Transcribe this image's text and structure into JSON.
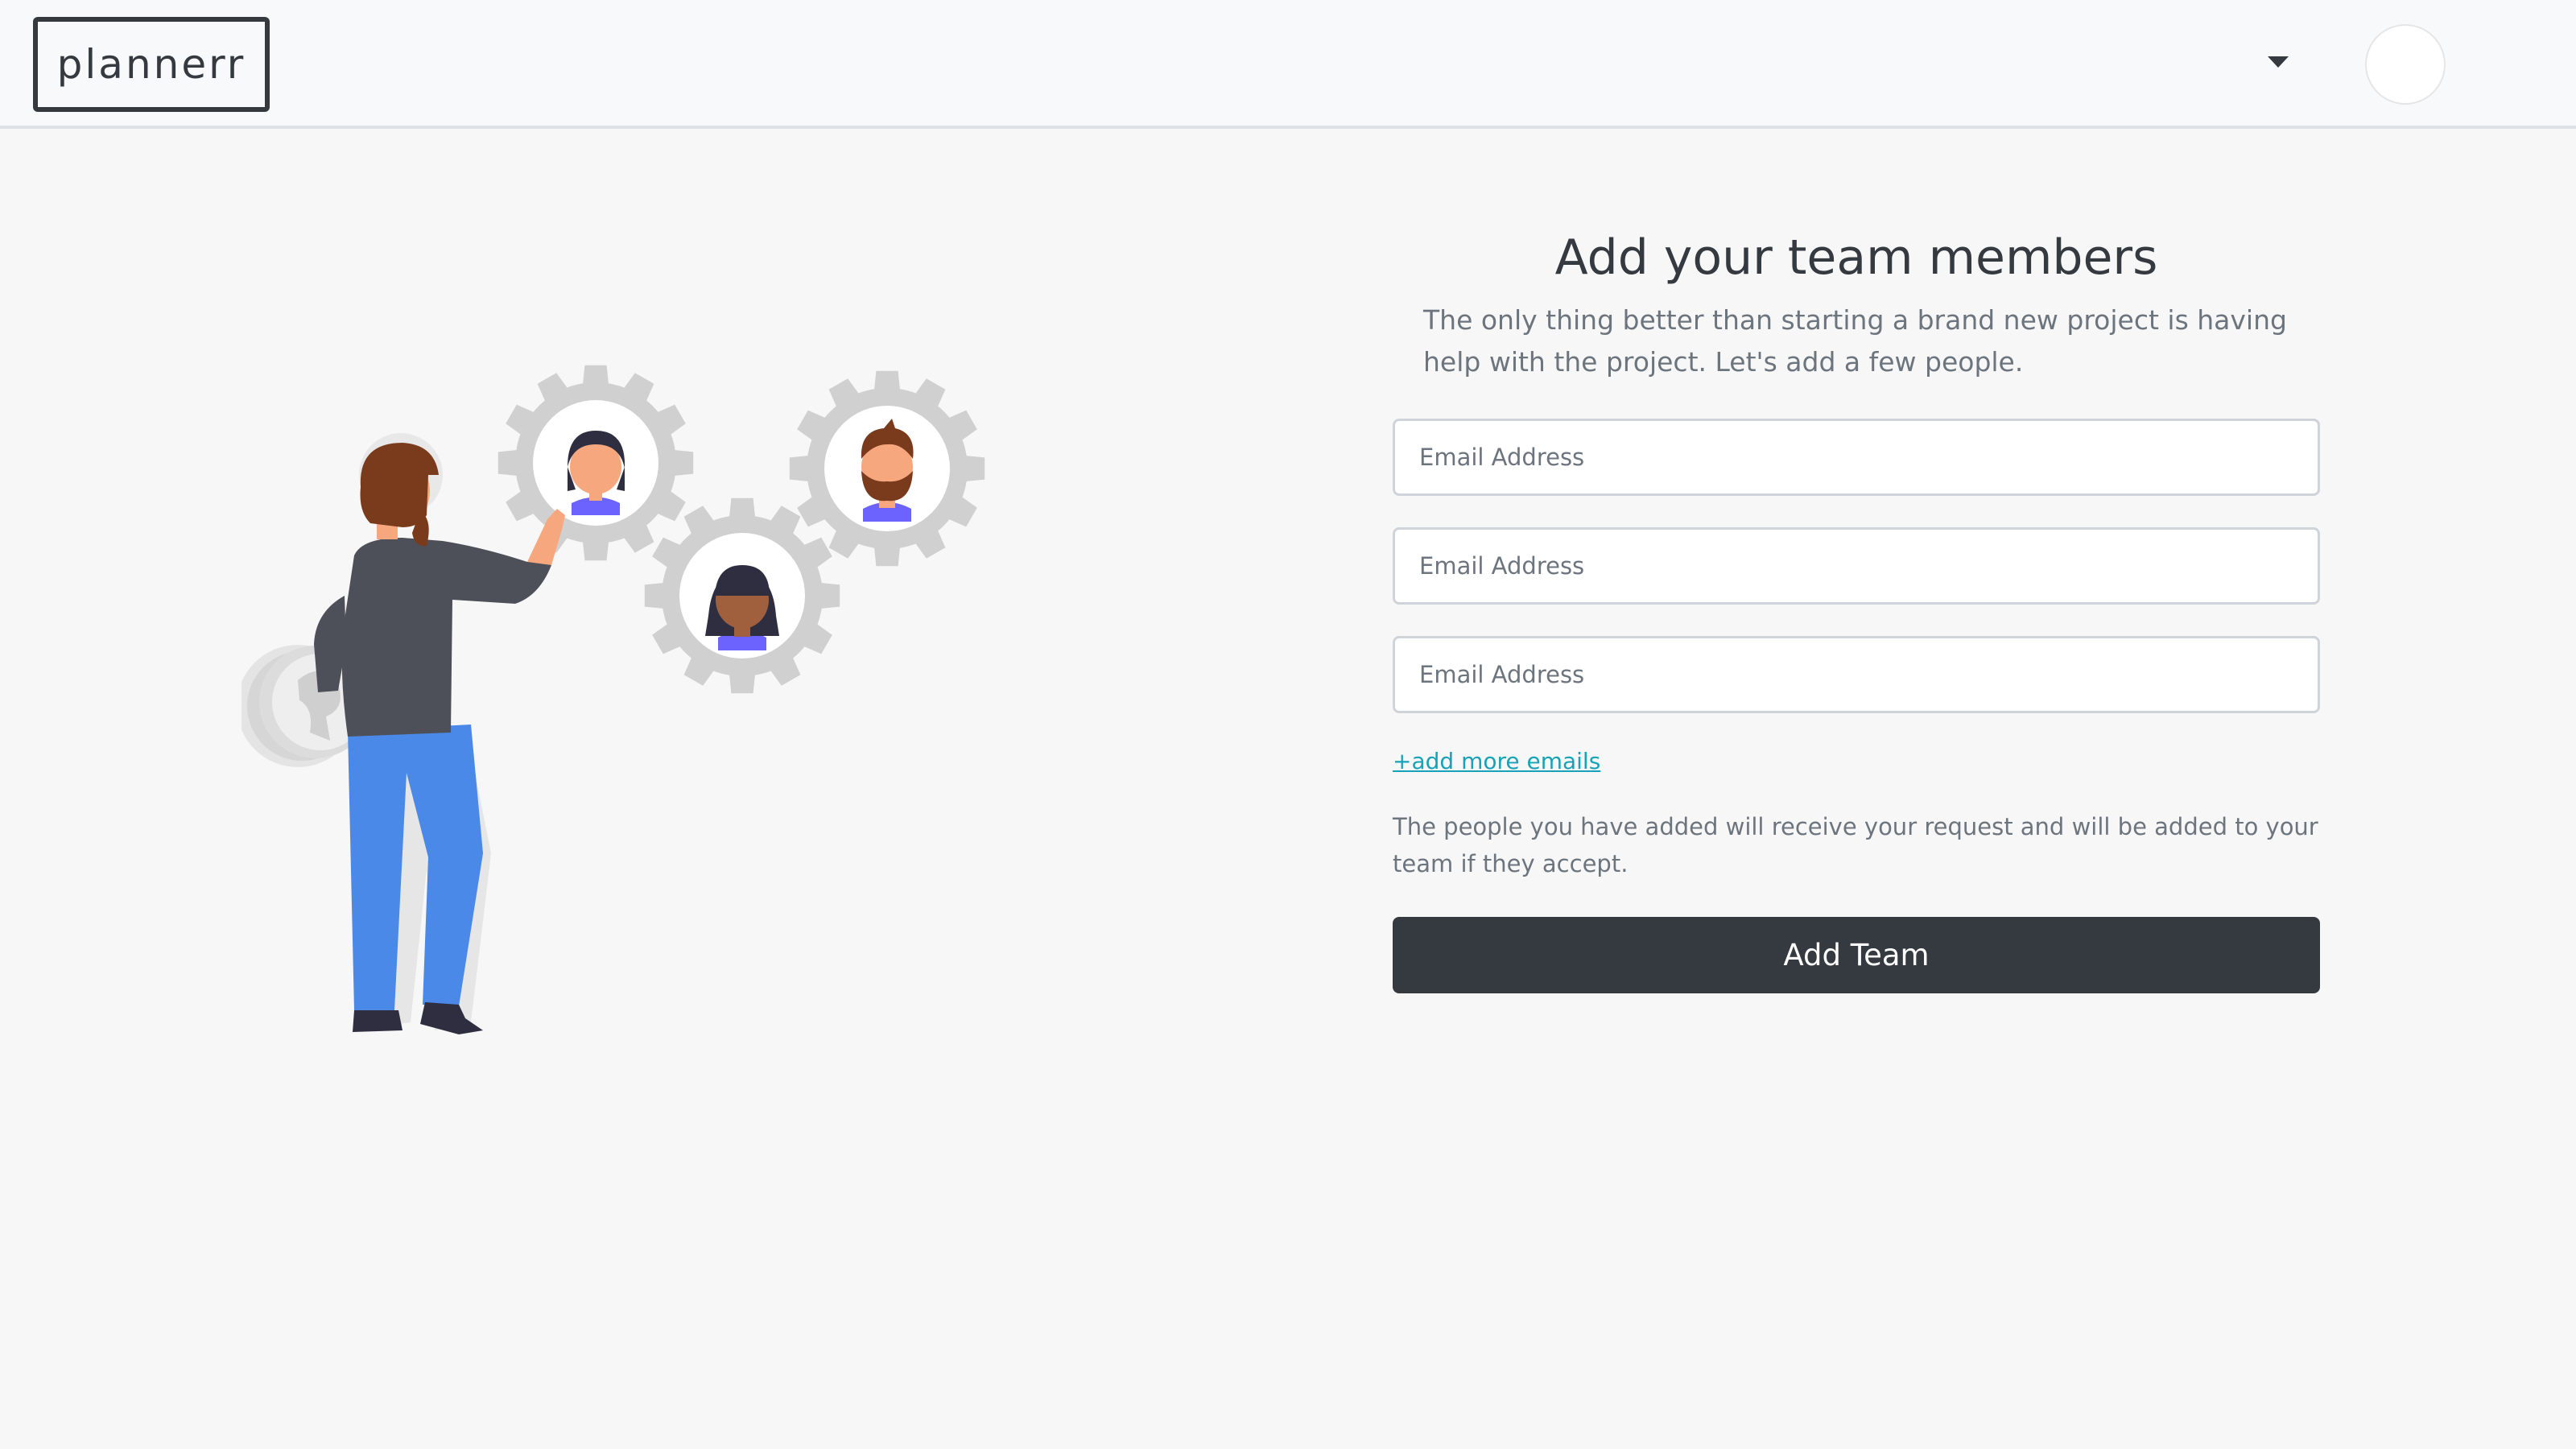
{
  "navbar": {
    "brand": "plannerr",
    "dropdown_icon": "caret-down-icon",
    "avatar_icon": "user-avatar"
  },
  "illustration": {
    "description_icon": "team-gears-illustration"
  },
  "form": {
    "title": "Add your team members",
    "subtitle": "The only thing better than starting a brand new project is having help with the project. Let's add a few people.",
    "email_fields": [
      {
        "placeholder": "Email Address",
        "value": ""
      },
      {
        "placeholder": "Email Address",
        "value": ""
      },
      {
        "placeholder": "Email Address",
        "value": ""
      }
    ],
    "add_more_link": "+add more emails",
    "note": "The people you have added will receive your request and will be added to your team if they accept.",
    "submit_label": "Add Team"
  },
  "colors": {
    "page_bg": "#f7f7f7",
    "navbar_bg": "#f8f9fa",
    "dark": "#343a40",
    "link": "#17a2b8",
    "muted": "#6c757d",
    "jeans": "#4a89e8",
    "shirt": "#4d5058",
    "hair": "#7a3a1c",
    "skin": "#f7a77e",
    "gear": "#d0d0d0",
    "collar": "#6c63ff"
  }
}
